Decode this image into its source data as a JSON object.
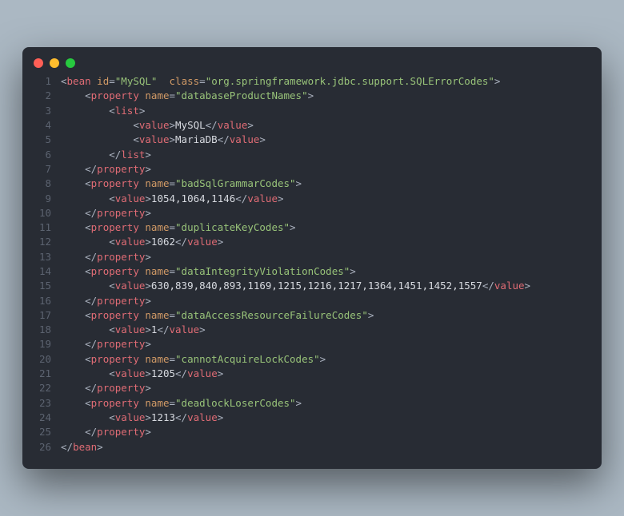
{
  "colors": {
    "bg": "#282c34",
    "pageBg": "#abb8c3",
    "dotRed": "#ff5f56",
    "dotYellow": "#ffbd2e",
    "dotGreen": "#27c93f",
    "lineNum": "#5c6370",
    "tag": "#e06c75",
    "attr": "#d19a66",
    "string": "#98c379",
    "text": "#d7dae0",
    "punct": "#abb2bf"
  },
  "lines": [
    {
      "n": "1",
      "indent": "",
      "tokens": [
        {
          "t": "pun",
          "v": "<"
        },
        {
          "t": "tag",
          "v": "bean"
        },
        {
          "t": "txt",
          "v": " "
        },
        {
          "t": "attr",
          "v": "id"
        },
        {
          "t": "pun",
          "v": "="
        },
        {
          "t": "str",
          "v": "\"MySQL\""
        },
        {
          "t": "txt",
          "v": "  "
        },
        {
          "t": "attr",
          "v": "class"
        },
        {
          "t": "pun",
          "v": "="
        },
        {
          "t": "str",
          "v": "\"org.springframework.jdbc.support.SQLErrorCodes\""
        },
        {
          "t": "pun",
          "v": ">"
        }
      ]
    },
    {
      "n": "2",
      "indent": "    ",
      "tokens": [
        {
          "t": "pun",
          "v": "<"
        },
        {
          "t": "tag",
          "v": "property"
        },
        {
          "t": "txt",
          "v": " "
        },
        {
          "t": "attr",
          "v": "name"
        },
        {
          "t": "pun",
          "v": "="
        },
        {
          "t": "str",
          "v": "\"databaseProductNames\""
        },
        {
          "t": "pun",
          "v": ">"
        }
      ]
    },
    {
      "n": "3",
      "indent": "        ",
      "tokens": [
        {
          "t": "pun",
          "v": "<"
        },
        {
          "t": "tag",
          "v": "list"
        },
        {
          "t": "pun",
          "v": ">"
        }
      ]
    },
    {
      "n": "4",
      "indent": "            ",
      "tokens": [
        {
          "t": "pun",
          "v": "<"
        },
        {
          "t": "tag",
          "v": "value"
        },
        {
          "t": "pun",
          "v": ">"
        },
        {
          "t": "txt",
          "v": "MySQL"
        },
        {
          "t": "pun",
          "v": "</"
        },
        {
          "t": "tag",
          "v": "value"
        },
        {
          "t": "pun",
          "v": ">"
        }
      ]
    },
    {
      "n": "5",
      "indent": "            ",
      "tokens": [
        {
          "t": "pun",
          "v": "<"
        },
        {
          "t": "tag",
          "v": "value"
        },
        {
          "t": "pun",
          "v": ">"
        },
        {
          "t": "txt",
          "v": "MariaDB"
        },
        {
          "t": "pun",
          "v": "</"
        },
        {
          "t": "tag",
          "v": "value"
        },
        {
          "t": "pun",
          "v": ">"
        }
      ]
    },
    {
      "n": "6",
      "indent": "        ",
      "tokens": [
        {
          "t": "pun",
          "v": "</"
        },
        {
          "t": "tag",
          "v": "list"
        },
        {
          "t": "pun",
          "v": ">"
        }
      ]
    },
    {
      "n": "7",
      "indent": "    ",
      "tokens": [
        {
          "t": "pun",
          "v": "</"
        },
        {
          "t": "tag",
          "v": "property"
        },
        {
          "t": "pun",
          "v": ">"
        }
      ]
    },
    {
      "n": "8",
      "indent": "    ",
      "tokens": [
        {
          "t": "pun",
          "v": "<"
        },
        {
          "t": "tag",
          "v": "property"
        },
        {
          "t": "txt",
          "v": " "
        },
        {
          "t": "attr",
          "v": "name"
        },
        {
          "t": "pun",
          "v": "="
        },
        {
          "t": "str",
          "v": "\"badSqlGrammarCodes\""
        },
        {
          "t": "pun",
          "v": ">"
        }
      ]
    },
    {
      "n": "9",
      "indent": "        ",
      "tokens": [
        {
          "t": "pun",
          "v": "<"
        },
        {
          "t": "tag",
          "v": "value"
        },
        {
          "t": "pun",
          "v": ">"
        },
        {
          "t": "txt",
          "v": "1054,1064,1146"
        },
        {
          "t": "pun",
          "v": "</"
        },
        {
          "t": "tag",
          "v": "value"
        },
        {
          "t": "pun",
          "v": ">"
        }
      ]
    },
    {
      "n": "10",
      "indent": "    ",
      "tokens": [
        {
          "t": "pun",
          "v": "</"
        },
        {
          "t": "tag",
          "v": "property"
        },
        {
          "t": "pun",
          "v": ">"
        }
      ]
    },
    {
      "n": "11",
      "indent": "    ",
      "tokens": [
        {
          "t": "pun",
          "v": "<"
        },
        {
          "t": "tag",
          "v": "property"
        },
        {
          "t": "txt",
          "v": " "
        },
        {
          "t": "attr",
          "v": "name"
        },
        {
          "t": "pun",
          "v": "="
        },
        {
          "t": "str",
          "v": "\"duplicateKeyCodes\""
        },
        {
          "t": "pun",
          "v": ">"
        }
      ]
    },
    {
      "n": "12",
      "indent": "        ",
      "tokens": [
        {
          "t": "pun",
          "v": "<"
        },
        {
          "t": "tag",
          "v": "value"
        },
        {
          "t": "pun",
          "v": ">"
        },
        {
          "t": "txt",
          "v": "1062"
        },
        {
          "t": "pun",
          "v": "</"
        },
        {
          "t": "tag",
          "v": "value"
        },
        {
          "t": "pun",
          "v": ">"
        }
      ]
    },
    {
      "n": "13",
      "indent": "    ",
      "tokens": [
        {
          "t": "pun",
          "v": "</"
        },
        {
          "t": "tag",
          "v": "property"
        },
        {
          "t": "pun",
          "v": ">"
        }
      ]
    },
    {
      "n": "14",
      "indent": "    ",
      "tokens": [
        {
          "t": "pun",
          "v": "<"
        },
        {
          "t": "tag",
          "v": "property"
        },
        {
          "t": "txt",
          "v": " "
        },
        {
          "t": "attr",
          "v": "name"
        },
        {
          "t": "pun",
          "v": "="
        },
        {
          "t": "str",
          "v": "\"dataIntegrityViolationCodes\""
        },
        {
          "t": "pun",
          "v": ">"
        }
      ]
    },
    {
      "n": "15",
      "indent": "        ",
      "tokens": [
        {
          "t": "pun",
          "v": "<"
        },
        {
          "t": "tag",
          "v": "value"
        },
        {
          "t": "pun",
          "v": ">"
        },
        {
          "t": "txt",
          "v": "630,839,840,893,1169,1215,1216,1217,1364,1451,1452,1557"
        },
        {
          "t": "pun",
          "v": "</"
        },
        {
          "t": "tag",
          "v": "value"
        },
        {
          "t": "pun",
          "v": ">"
        }
      ]
    },
    {
      "n": "16",
      "indent": "    ",
      "tokens": [
        {
          "t": "pun",
          "v": "</"
        },
        {
          "t": "tag",
          "v": "property"
        },
        {
          "t": "pun",
          "v": ">"
        }
      ]
    },
    {
      "n": "17",
      "indent": "    ",
      "tokens": [
        {
          "t": "pun",
          "v": "<"
        },
        {
          "t": "tag",
          "v": "property"
        },
        {
          "t": "txt",
          "v": " "
        },
        {
          "t": "attr",
          "v": "name"
        },
        {
          "t": "pun",
          "v": "="
        },
        {
          "t": "str",
          "v": "\"dataAccessResourceFailureCodes\""
        },
        {
          "t": "pun",
          "v": ">"
        }
      ]
    },
    {
      "n": "18",
      "indent": "        ",
      "tokens": [
        {
          "t": "pun",
          "v": "<"
        },
        {
          "t": "tag",
          "v": "value"
        },
        {
          "t": "pun",
          "v": ">"
        },
        {
          "t": "txt",
          "v": "1"
        },
        {
          "t": "pun",
          "v": "</"
        },
        {
          "t": "tag",
          "v": "value"
        },
        {
          "t": "pun",
          "v": ">"
        }
      ]
    },
    {
      "n": "19",
      "indent": "    ",
      "tokens": [
        {
          "t": "pun",
          "v": "</"
        },
        {
          "t": "tag",
          "v": "property"
        },
        {
          "t": "pun",
          "v": ">"
        }
      ]
    },
    {
      "n": "20",
      "indent": "    ",
      "tokens": [
        {
          "t": "pun",
          "v": "<"
        },
        {
          "t": "tag",
          "v": "property"
        },
        {
          "t": "txt",
          "v": " "
        },
        {
          "t": "attr",
          "v": "name"
        },
        {
          "t": "pun",
          "v": "="
        },
        {
          "t": "str",
          "v": "\"cannotAcquireLockCodes\""
        },
        {
          "t": "pun",
          "v": ">"
        }
      ]
    },
    {
      "n": "21",
      "indent": "        ",
      "tokens": [
        {
          "t": "pun",
          "v": "<"
        },
        {
          "t": "tag",
          "v": "value"
        },
        {
          "t": "pun",
          "v": ">"
        },
        {
          "t": "txt",
          "v": "1205"
        },
        {
          "t": "pun",
          "v": "</"
        },
        {
          "t": "tag",
          "v": "value"
        },
        {
          "t": "pun",
          "v": ">"
        }
      ]
    },
    {
      "n": "22",
      "indent": "    ",
      "tokens": [
        {
          "t": "pun",
          "v": "</"
        },
        {
          "t": "tag",
          "v": "property"
        },
        {
          "t": "pun",
          "v": ">"
        }
      ]
    },
    {
      "n": "23",
      "indent": "    ",
      "tokens": [
        {
          "t": "pun",
          "v": "<"
        },
        {
          "t": "tag",
          "v": "property"
        },
        {
          "t": "txt",
          "v": " "
        },
        {
          "t": "attr",
          "v": "name"
        },
        {
          "t": "pun",
          "v": "="
        },
        {
          "t": "str",
          "v": "\"deadlockLoserCodes\""
        },
        {
          "t": "pun",
          "v": ">"
        }
      ]
    },
    {
      "n": "24",
      "indent": "        ",
      "tokens": [
        {
          "t": "pun",
          "v": "<"
        },
        {
          "t": "tag",
          "v": "value"
        },
        {
          "t": "pun",
          "v": ">"
        },
        {
          "t": "txt",
          "v": "1213"
        },
        {
          "t": "pun",
          "v": "</"
        },
        {
          "t": "tag",
          "v": "value"
        },
        {
          "t": "pun",
          "v": ">"
        }
      ]
    },
    {
      "n": "25",
      "indent": "    ",
      "tokens": [
        {
          "t": "pun",
          "v": "</"
        },
        {
          "t": "tag",
          "v": "property"
        },
        {
          "t": "pun",
          "v": ">"
        }
      ]
    },
    {
      "n": "26",
      "indent": "",
      "tokens": [
        {
          "t": "pun",
          "v": "</"
        },
        {
          "t": "tag",
          "v": "bean"
        },
        {
          "t": "pun",
          "v": ">"
        }
      ]
    }
  ]
}
